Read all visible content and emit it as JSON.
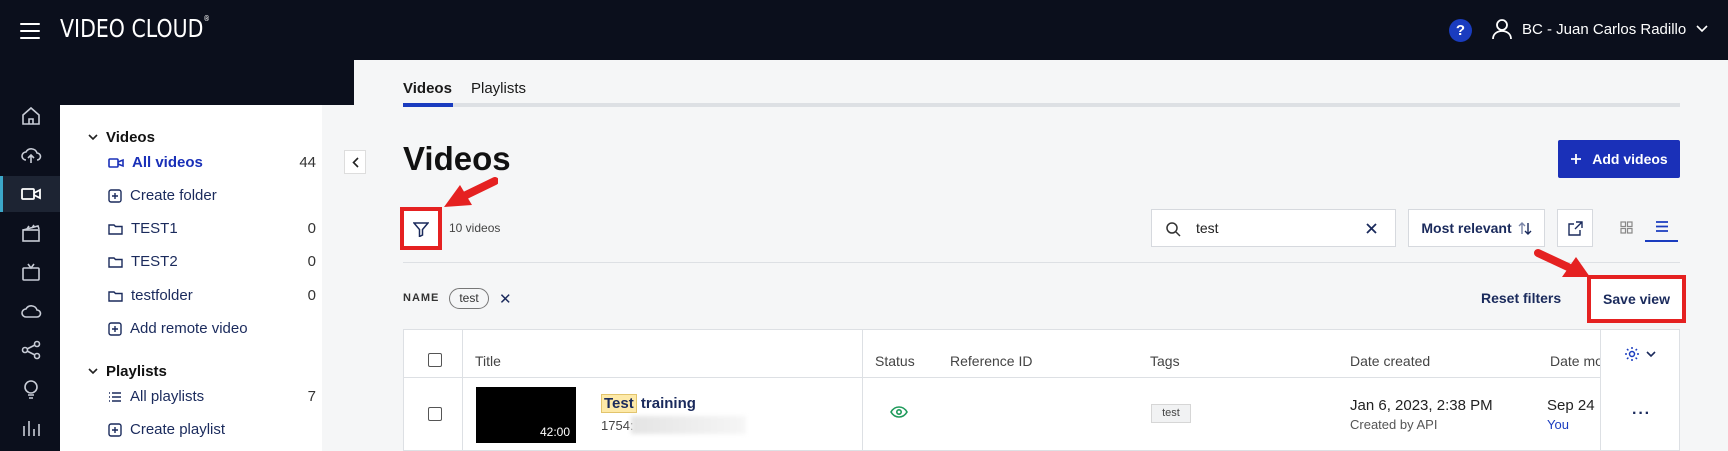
{
  "header": {
    "brand": "VIDEO CLOUD",
    "brand_mark": "®",
    "help": "?",
    "user_name": "BC - Juan Carlos Radillo"
  },
  "rail": {
    "icons": [
      "home-icon",
      "upload-icon",
      "video-camera-icon",
      "clapper-icon",
      "tv-icon",
      "cloud-icon",
      "share-icon",
      "lightbulb-icon",
      "analytics-icon"
    ],
    "active": "video-camera-icon",
    "accent": "#3ca7c9"
  },
  "folders": {
    "videos_header": "Videos",
    "all_videos": "All videos",
    "all_videos_count": "44",
    "create_folder": "Create folder",
    "items": [
      {
        "label": "TEST1",
        "count": "0"
      },
      {
        "label": "TEST2",
        "count": "0"
      },
      {
        "label": "testfolder",
        "count": "0"
      }
    ],
    "add_remote": "Add remote video",
    "playlists_header": "Playlists",
    "all_playlists": "All playlists",
    "all_playlists_count": "7",
    "create_playlist": "Create playlist"
  },
  "tabs": [
    {
      "label": "Videos",
      "active": true
    },
    {
      "label": "Playlists",
      "active": false
    }
  ],
  "page": {
    "title": "Videos",
    "add_button": "Add videos",
    "count_text": "10 videos"
  },
  "search": {
    "value": "test"
  },
  "sort": {
    "label": "Most relevant"
  },
  "filters": {
    "name_label": "NAME",
    "chip": "test",
    "reset": "Reset filters",
    "save_view": "Save view"
  },
  "table": {
    "columns": [
      "Title",
      "Status",
      "Reference ID",
      "Tags",
      "Date created",
      "Date mo"
    ],
    "rows": [
      {
        "duration": "42:00",
        "title_highlight": "Test",
        "title_rest": "training",
        "id_prefix": "1754:",
        "tag": "test",
        "date_created": "Jan 6, 2023, 2:38 PM",
        "created_by": "Created by API",
        "date_modified": "Sep 24",
        "modified_by": "You",
        "menu": "···"
      }
    ]
  },
  "colors": {
    "topbar": "#0b0f1c",
    "primary": "#1a30b8",
    "highlight_box": "#e52121",
    "link": "#1a2a5c"
  }
}
